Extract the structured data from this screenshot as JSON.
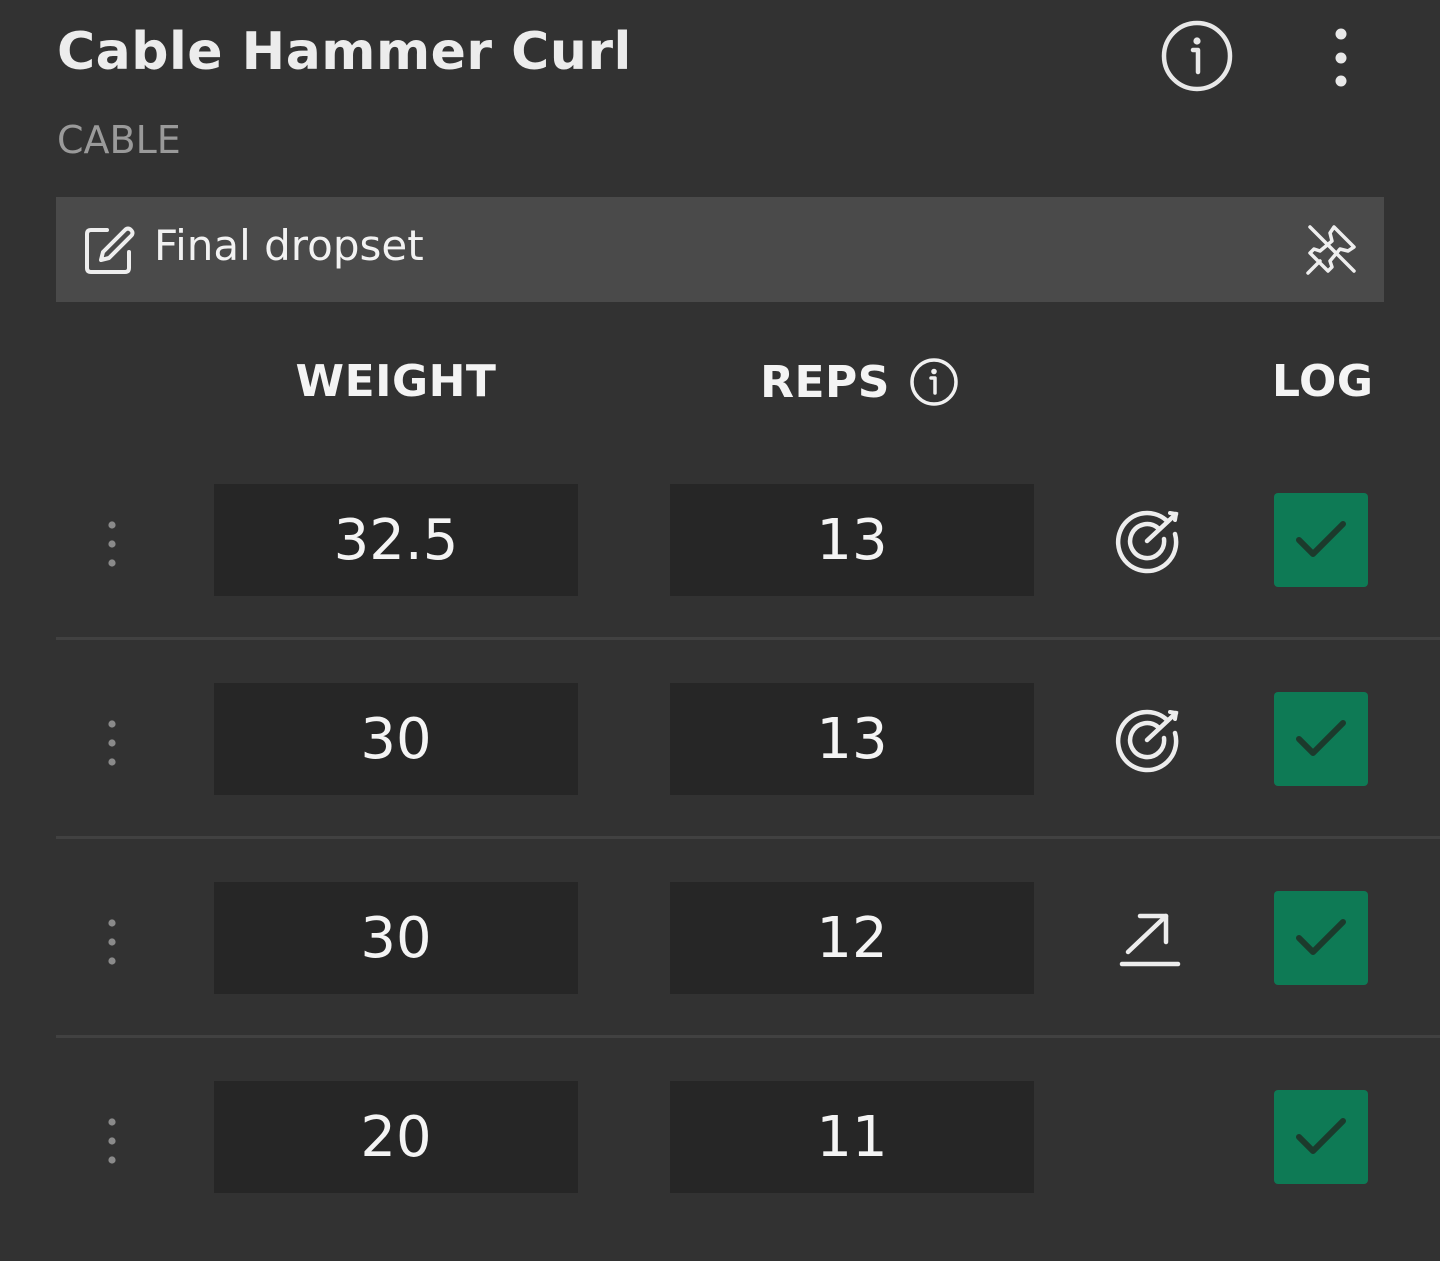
{
  "exercise": {
    "title": "Cable Hammer Curl",
    "equipment": "CABLE",
    "header_icons": {
      "info": "info-circle-icon",
      "more": "more-vertical-icon"
    }
  },
  "note": {
    "text": "Final dropset",
    "edit_icon": "edit-note-icon",
    "unpin_icon": "unpin-icon"
  },
  "columns": {
    "weight": "WEIGHT",
    "reps": "REPS",
    "log": "LOG"
  },
  "sets": [
    {
      "weight": "32.5",
      "reps": "13",
      "status_icon": "target-icon",
      "logged": true
    },
    {
      "weight": "30",
      "reps": "13",
      "status_icon": "target-icon",
      "logged": true
    },
    {
      "weight": "30",
      "reps": "12",
      "status_icon": "progress-arrow-icon",
      "logged": true
    },
    {
      "weight": "20",
      "reps": "11",
      "status_icon": "",
      "logged": true
    }
  ],
  "colors": {
    "background": "#323232",
    "input_bg": "#262626",
    "note_bg": "#4a4a4a",
    "log_green": "#0e7a55",
    "check_dark": "#1c3a2c"
  }
}
